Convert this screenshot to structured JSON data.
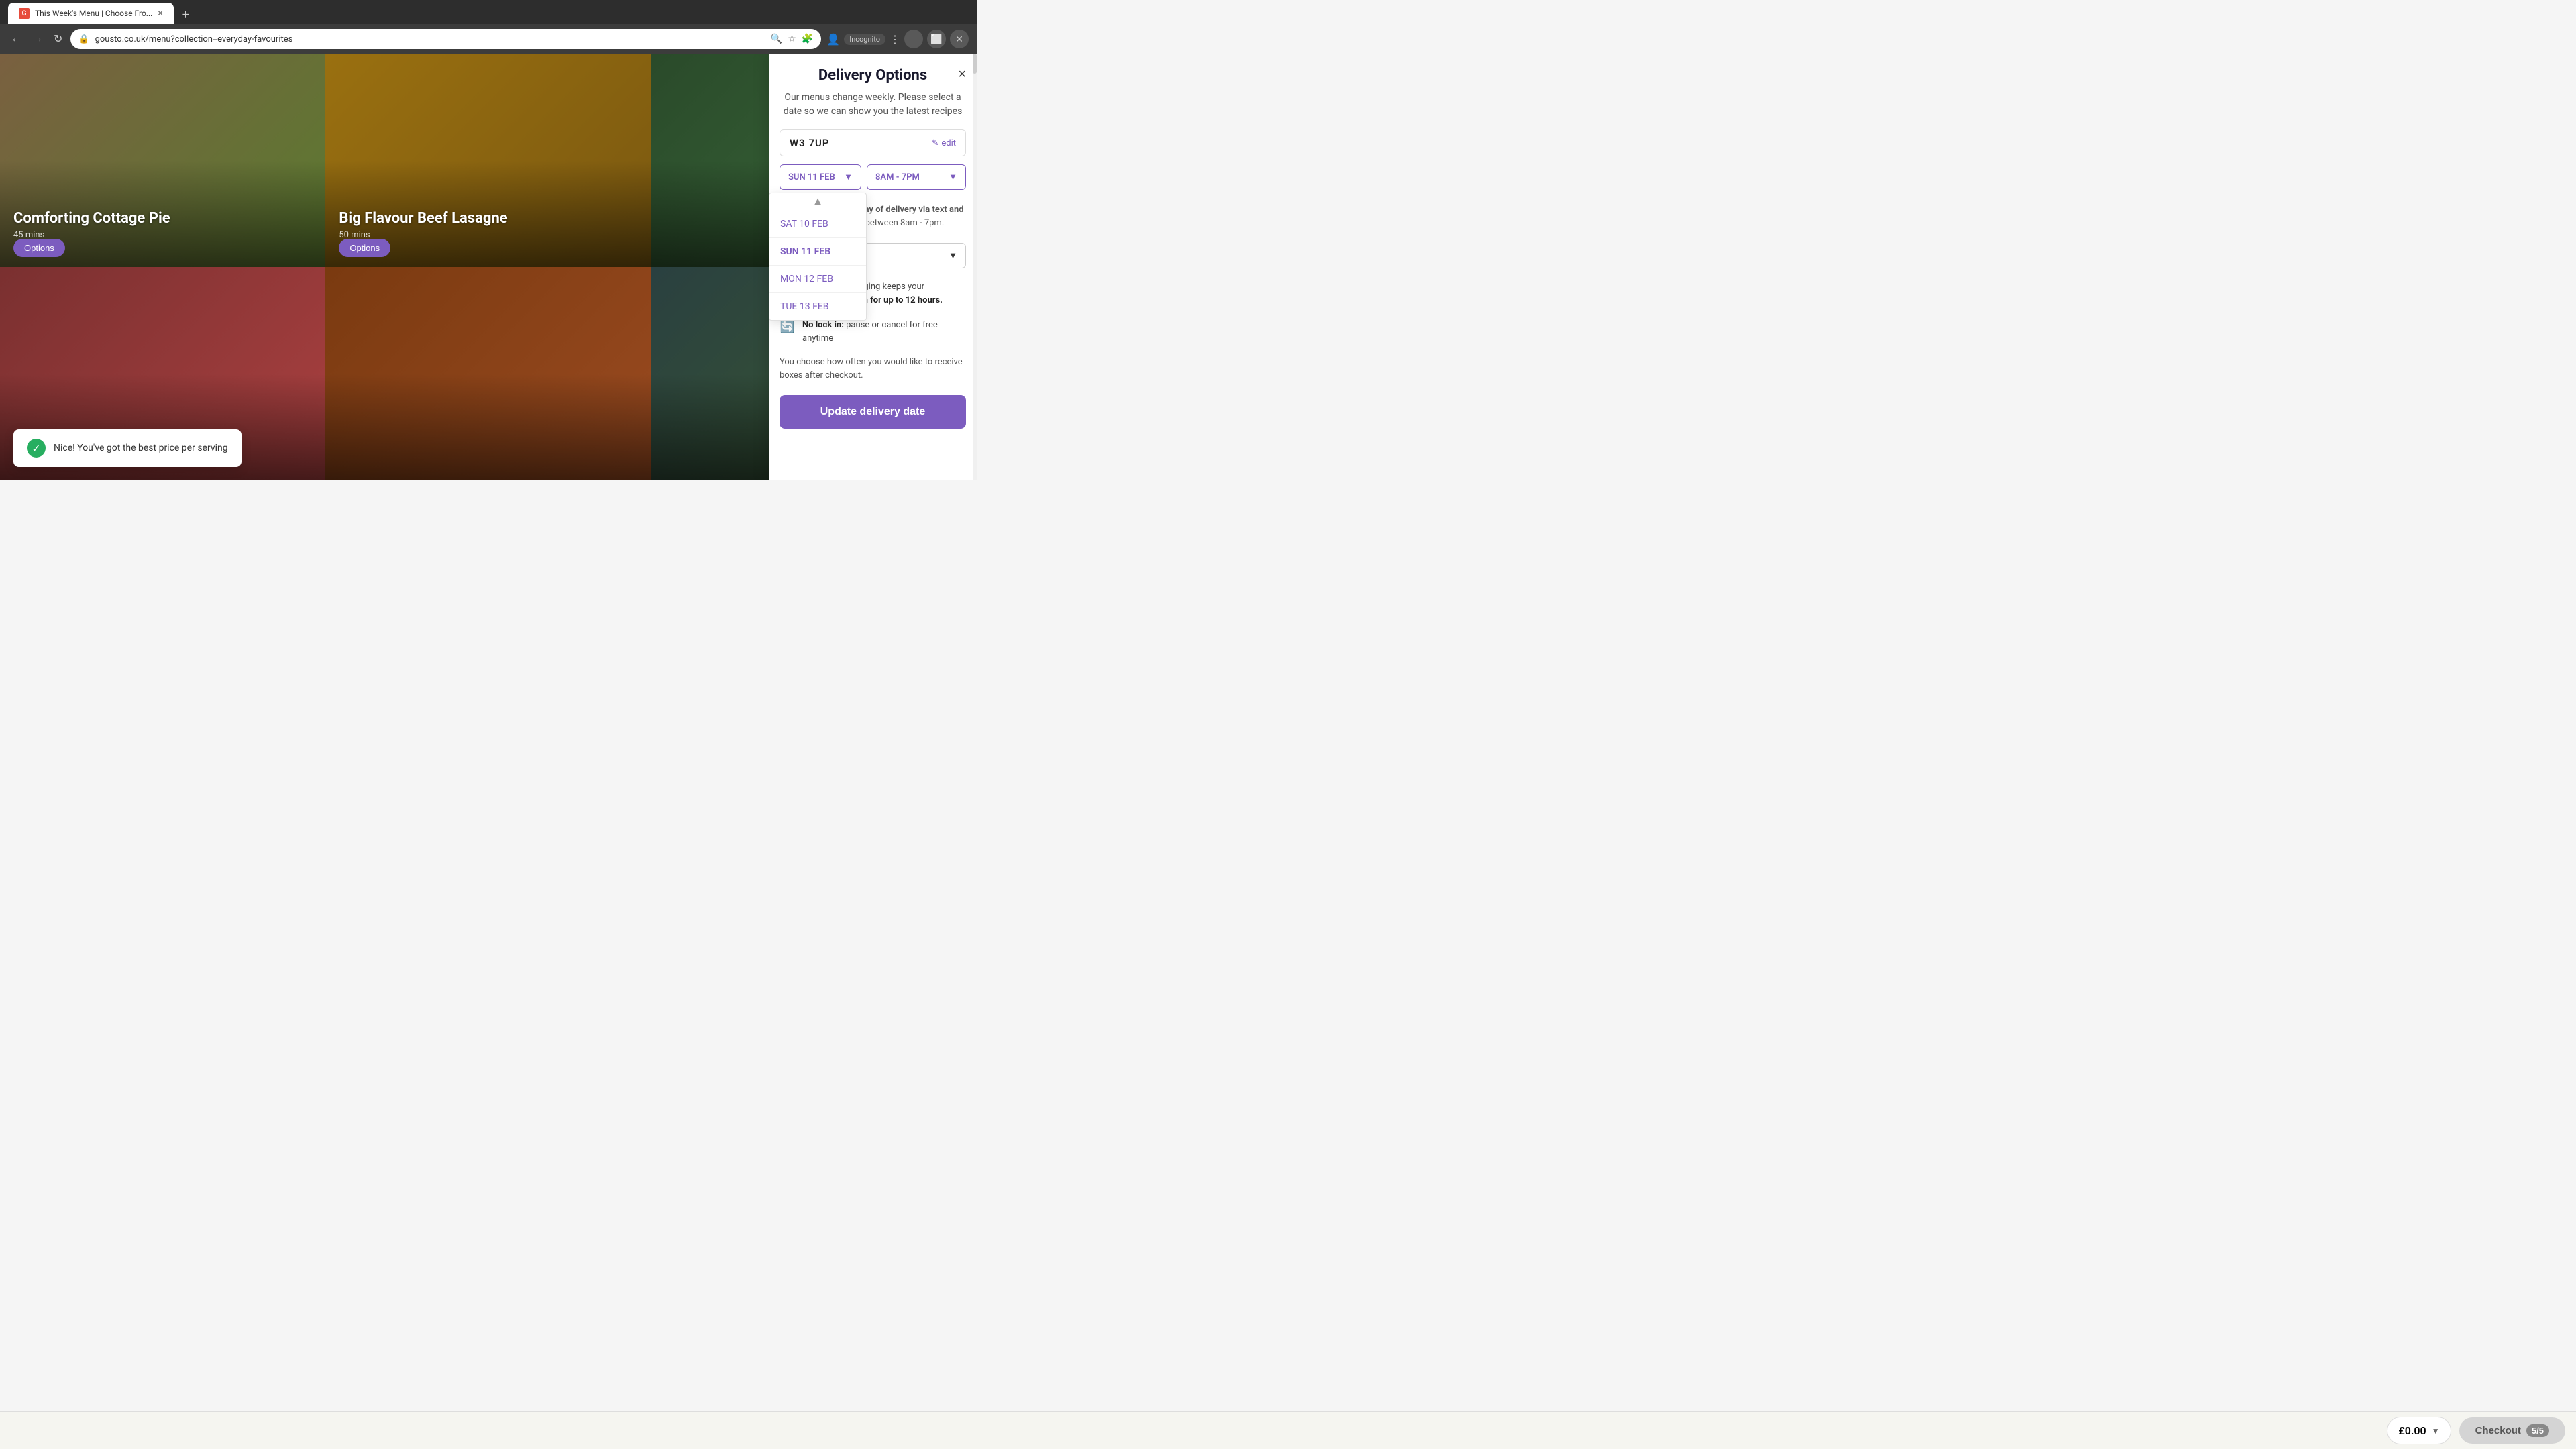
{
  "browser": {
    "tab_title": "This Week's Menu | Choose Fro...",
    "url": "gousto.co.uk/menu?collection=everyday-favourites",
    "incognito_label": "Incognito"
  },
  "food_cards": [
    {
      "id": 1,
      "name": "Comforting Cottage Pie",
      "sub": "45 mins",
      "color1": "#7a6040",
      "color2": "#5a7a30"
    },
    {
      "id": 2,
      "name": "Big Flavour Beef Lasagne",
      "sub": "50 mins",
      "color1": "#9a7010",
      "color2": "#7a5810"
    },
    {
      "id": 3,
      "name": "",
      "sub": "",
      "color1": "#2a4a2a",
      "color2": "#3a6a3a"
    },
    {
      "id": 4,
      "name": "",
      "sub": "",
      "color1": "#7a3030",
      "color2": "#aa4040"
    },
    {
      "id": 5,
      "name": "",
      "sub": "",
      "color1": "#7a3a10",
      "color2": "#9a4a20"
    },
    {
      "id": 6,
      "name": "",
      "sub": "",
      "color1": "#2a4040",
      "color2": "#3a5a30"
    }
  ],
  "options_button_label": "Options",
  "toast": {
    "text": "Nice! You've got the best price per serving",
    "icon": "✓"
  },
  "delivery_panel": {
    "title": "Delivery Options",
    "close_icon": "×",
    "subtitle": "Our menus change weekly. Please select a date so we can show you the latest recipes",
    "postcode": "W3 7UP",
    "edit_label": "edit",
    "edit_icon": "✎",
    "selected_date": "SUN 11 FEB",
    "selected_time": "8AM - 7PM",
    "date_options": [
      {
        "value": "SAT 10 FEB",
        "label": "SAT 10 FEB"
      },
      {
        "value": "SUN 11 FEB",
        "label": "SUN 11 FEB"
      },
      {
        "value": "MON 12 FEB",
        "label": "MON 12 FEB"
      },
      {
        "value": "TUE 13 FEB",
        "label": "TUE 13 FEB"
      }
    ],
    "time_info_text": "r delivery slot on the day of delivery via text and email. Delivery will be between 8am - 7pm.",
    "fresh_text": "Insulated packaging keeps your ingredients ",
    "fresh_highlight": "fresh for up to 12 hours.",
    "nolock_title": "No lock in:",
    "nolock_text": " pause or cancel for free anytime",
    "you_choose_text": "You choose how often you would like to receive boxes after checkout.",
    "update_button": "Update delivery date"
  },
  "bottom_bar": {
    "price": "£0.00",
    "checkout_label": "Checkout",
    "checkout_count": "5/5"
  }
}
